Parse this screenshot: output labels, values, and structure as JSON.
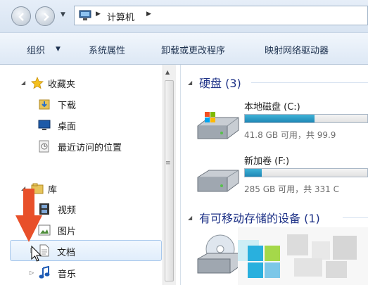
{
  "address": {
    "crumbs": [
      "计算机"
    ]
  },
  "toolbar": {
    "organize": "组织",
    "properties": "系统属性",
    "uninstall": "卸载或更改程序",
    "map_drive": "映射网络驱动器"
  },
  "nav": {
    "favorites": {
      "label": "收藏夹",
      "items": [
        "下载",
        "桌面",
        "最近访问的位置"
      ]
    },
    "libraries": {
      "label": "库",
      "items": [
        "视频",
        "图片",
        "文档",
        "音乐"
      ]
    }
  },
  "main": {
    "hard_disks": {
      "header": "硬盘 (3)",
      "drives": [
        {
          "name": "本地磁盘 (C:)",
          "info": "41.8 GB 可用，共 99.9",
          "used_fraction": 0.57
        },
        {
          "name": "新加卷 (F:)",
          "info": "285 GB 可用，共 331 C",
          "used_fraction": 0.14
        }
      ]
    },
    "removable": {
      "header": "有可移动存储的设备 (1)"
    }
  },
  "colors": {
    "accent_red": "#e8502a",
    "bar_fill": "#2596c4",
    "header_blue": "#1e3287"
  }
}
